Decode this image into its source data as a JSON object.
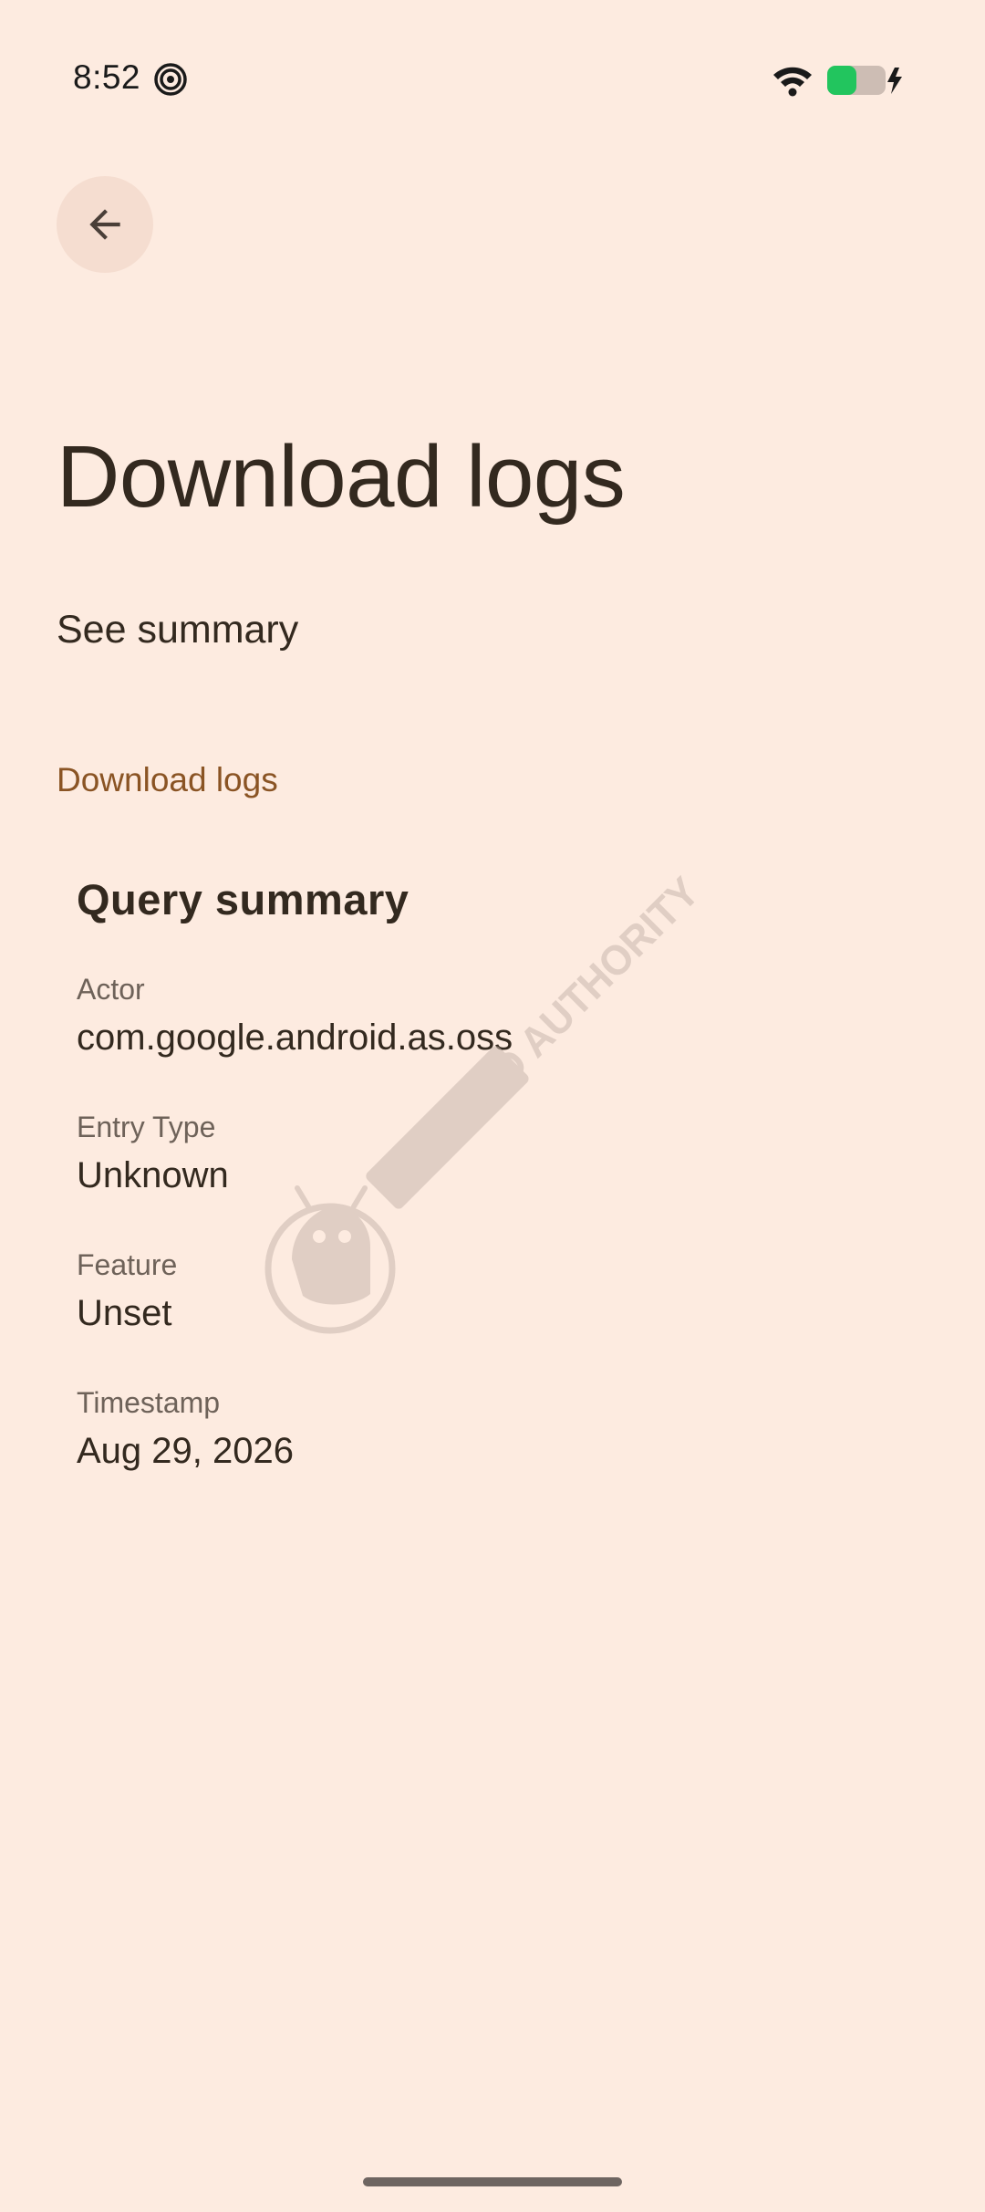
{
  "status_bar": {
    "time": "8:52",
    "icons": [
      "swirl-icon",
      "wifi-icon",
      "battery-charging-icon"
    ],
    "battery_level": 0.5,
    "battery_fill_color": "#22c55e"
  },
  "header": {
    "back_icon": "arrow-back-icon"
  },
  "page": {
    "title": "Download logs",
    "see_summary": "See summary",
    "section_link": "Download logs"
  },
  "summary": {
    "heading": "Query summary",
    "fields": [
      {
        "label": "Actor",
        "value": "com.google.android.as.oss"
      },
      {
        "label": "Entry Type",
        "value": "Unknown"
      },
      {
        "label": "Feature",
        "value": "Unset"
      },
      {
        "label": "Timestamp",
        "value": "Aug 29, 2026"
      }
    ]
  },
  "watermark": {
    "text": "ANDROID AUTHORITY"
  },
  "colors": {
    "background": "#fdebe0",
    "text_primary": "#33291f",
    "text_secondary": "#6e6259",
    "accent": "#8a5424",
    "back_button_bg": "#f5ddd0"
  }
}
